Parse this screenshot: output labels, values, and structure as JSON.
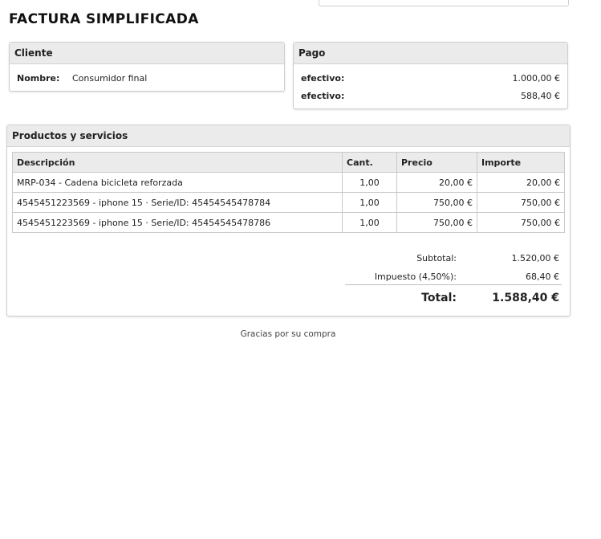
{
  "title": "FACTURA SIMPLIFICADA",
  "cliente": {
    "heading": "Cliente",
    "label": "Nombre:",
    "value": "Consumidor final"
  },
  "pago": {
    "heading": "Pago",
    "rows": [
      {
        "label": "efectivo:",
        "amount": "1.000,00 €"
      },
      {
        "label": "efectivo:",
        "amount": "588,40 €"
      }
    ]
  },
  "productos": {
    "heading": "Productos y servicios",
    "columns": [
      "Descripción",
      "Cant.",
      "Precio",
      "Importe"
    ],
    "rows": [
      {
        "descripcion": "MRP-034 - Cadena bicicleta reforzada",
        "cant": "1,00",
        "precio": "20,00 €",
        "importe": "20,00 €"
      },
      {
        "descripcion": "4545451223569 - iphone 15 · Serie/ID: 45454545478784",
        "cant": "1,00",
        "precio": "750,00 €",
        "importe": "750,00 €"
      },
      {
        "descripcion": "4545451223569 - iphone 15 · Serie/ID: 45454545478786",
        "cant": "1,00",
        "precio": "750,00 €",
        "importe": "750,00 €"
      }
    ]
  },
  "totales": {
    "subtotal_label": "Subtotal:",
    "subtotal": "1.520,00 €",
    "impuesto_label": "Impuesto (4,50%):",
    "impuesto": "68,40 €",
    "total_label": "Total:",
    "total": "1.588,40 €"
  },
  "footer": "Gracias por su compra"
}
